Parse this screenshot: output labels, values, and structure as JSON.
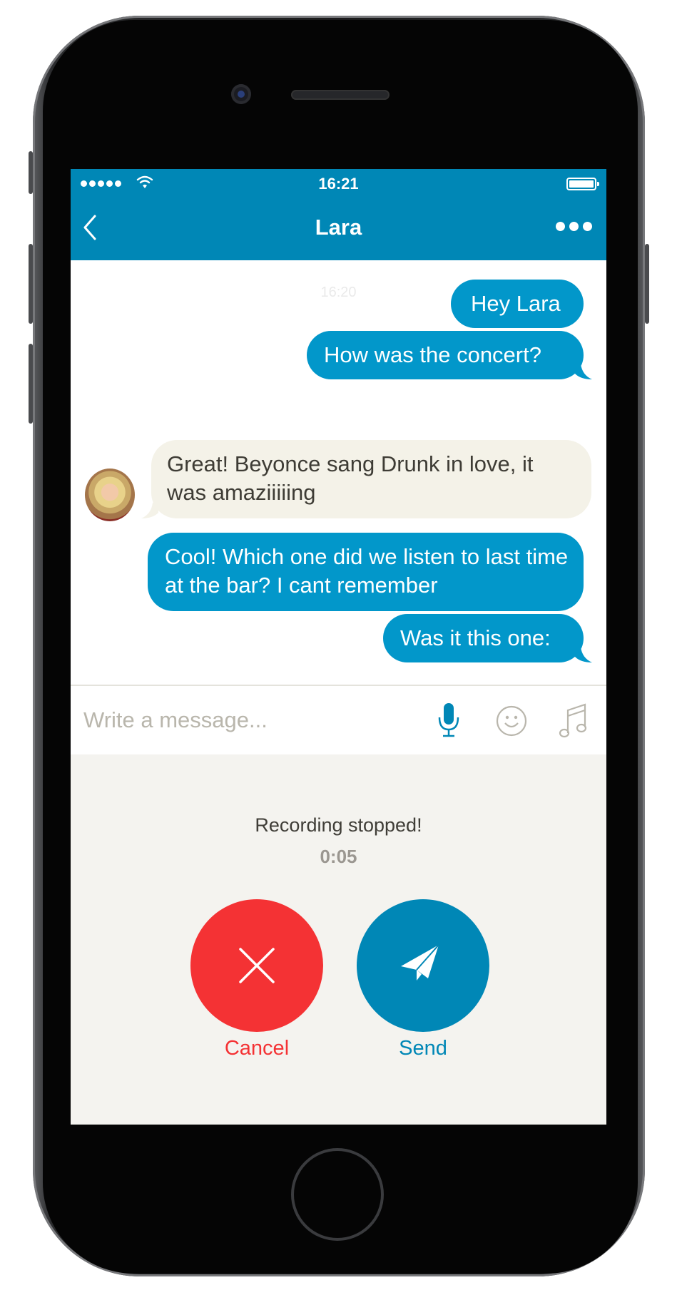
{
  "status_bar": {
    "time": "16:21",
    "signal_bars": 5
  },
  "header": {
    "title": "Lara",
    "back_icon": "chevron-left-icon",
    "more_icon": "more-horizontal-icon"
  },
  "conversation": {
    "timestamp": "16:20",
    "messages": [
      {
        "direction": "outgoing",
        "text": "Hey Lara"
      },
      {
        "direction": "outgoing",
        "text": "How was the concert?"
      },
      {
        "direction": "incoming",
        "sender": "Lara",
        "text": "Great! Beyonce sang Drunk in love, it was amaziiiiing"
      },
      {
        "direction": "outgoing",
        "text": "Cool! Which one did we listen to last time at the bar? I cant remember"
      },
      {
        "direction": "outgoing",
        "text": "Was it this one:"
      }
    ]
  },
  "composer": {
    "placeholder": "Write a message...",
    "value": "",
    "icons": [
      "microphone-icon",
      "emoji-icon",
      "music-note-icon"
    ]
  },
  "recording": {
    "status": "Recording stopped!",
    "duration": "0:05",
    "cancel_label": "Cancel",
    "send_label": "Send"
  },
  "colors": {
    "brand": "#0087b6",
    "outgoing_bubble": "#0297ca",
    "incoming_bubble": "#f4f2e8",
    "cancel": "#f43234",
    "panel_bg": "#f4f3ef"
  }
}
